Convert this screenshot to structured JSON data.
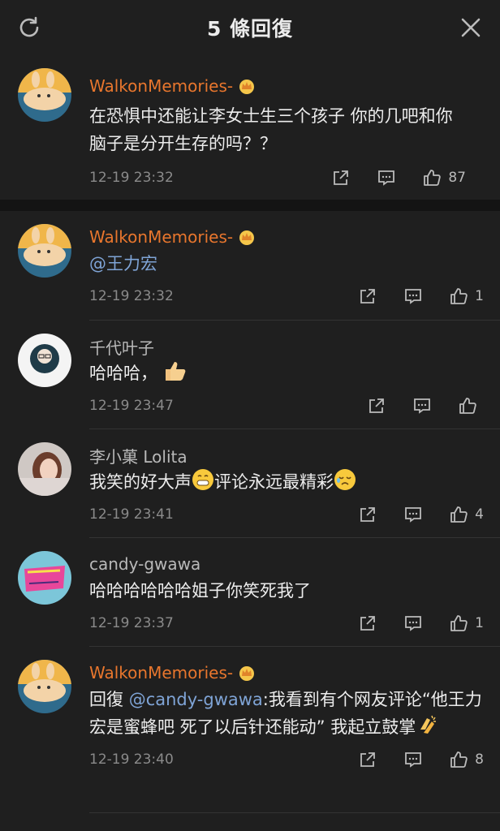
{
  "header": {
    "title": "5 條回復",
    "refresh_icon": "refresh-icon",
    "close_icon": "close-icon"
  },
  "main_comment": {
    "author": "WalkonMemories-",
    "crown": "crown-icon",
    "text": "在恐惧中还能让李女士生三个孩子 你的几吧和你脑子是分开生存的吗？？",
    "time": "12-19 23:32",
    "likes": "87"
  },
  "replies": [
    {
      "author": "WalkonMemories-",
      "mention": "@王力宏",
      "time": "12-19 23:32",
      "likes": "1"
    },
    {
      "author": "千代叶子",
      "text": "哈哈哈，",
      "emoji": "thumbs-up-emoji",
      "time": "12-19 23:47",
      "likes": ""
    },
    {
      "author": "李小菓 Lolita",
      "text_a": "我笑的好大声",
      "text_b": "评论永远最精彩",
      "emoji_a": "grin-emoji",
      "emoji_b": "tearful-emoji",
      "time": "12-19 23:41",
      "likes": "4"
    },
    {
      "author": "candy-gwawa",
      "text": "哈哈哈哈哈哈姐子你笑死我了",
      "time": "12-19 23:37",
      "likes": "1"
    },
    {
      "author": "WalkonMemories-",
      "reply_prefix": "回復",
      "mention": "@candy-gwawa",
      "text": ":我看到有个网友评论“他王力宏是蜜蜂吧 死了以后针还能动” 我起立鼓掌",
      "emoji": "clapping-emoji",
      "time": "12-19 23:40",
      "likes": "8"
    }
  ],
  "colors": {
    "background": "#1f1f1f",
    "vip_name": "#e8762d",
    "mention": "#7fa4d6"
  }
}
